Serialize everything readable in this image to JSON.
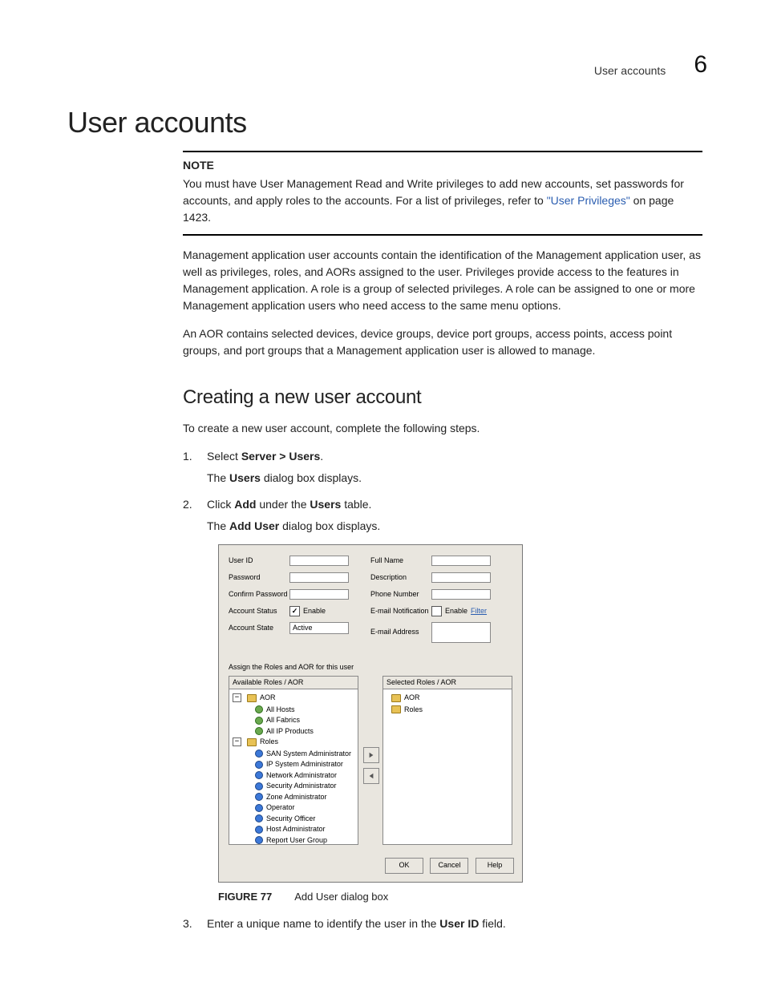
{
  "header": {
    "section": "User accounts",
    "chapter_num": "6"
  },
  "title": "User accounts",
  "note": {
    "label": "NOTE",
    "text_a": "You must have User Management Read and Write privileges to add new accounts, set passwords for accounts, and apply roles to the accounts. For a list of privileges, refer to ",
    "link": "\"User Privileges\"",
    "text_b": " on page 1423."
  },
  "para1": "Management application user accounts contain the identification of the Management application user, as well as privileges, roles, and AORs assigned to the user. Privileges provide access to the features in Management application. A role is a group of selected privileges. A role can be assigned to one or more Management application users who need access to the same menu options.",
  "para2": "An AOR contains selected devices, device groups, device port groups, access points, access point groups, and port groups that a Management application user is allowed to manage.",
  "subheading": "Creating a new user account",
  "intro": "To create a new user account, complete the following steps.",
  "steps": {
    "s1": {
      "pre": "Select ",
      "bold": "Server > Users",
      "post": ".",
      "after_pre": "The ",
      "after_bold": "Users",
      "after_post": " dialog box displays."
    },
    "s2": {
      "pre": "Click ",
      "b1": "Add",
      "mid": " under the ",
      "b2": "Users",
      "post": " table.",
      "after_pre": "The ",
      "after_bold": "Add User",
      "after_post": " dialog box displays."
    },
    "s3": {
      "pre": "Enter a unique name to identify the user in the ",
      "bold": "User ID",
      "post": " field."
    }
  },
  "dialog": {
    "left_labels": {
      "user_id": "User ID",
      "password": "Password",
      "confirm": "Confirm Password",
      "acct_status": "Account Status",
      "acct_state": "Account State"
    },
    "right_labels": {
      "full_name": "Full Name",
      "desc": "Description",
      "phone": "Phone Number",
      "email_notif": "E-mail Notification",
      "email_addr": "E-mail Address"
    },
    "enable": "Enable",
    "state_value": "Active",
    "filter": "Filter",
    "assign": "Assign the Roles and AOR for this user",
    "avail_hdr": "Available Roles / AOR",
    "sel_hdr": "Selected Roles / AOR",
    "aor_root": "AOR",
    "aor_items": [
      "All Hosts",
      "All Fabrics",
      "All IP Products"
    ],
    "roles_root": "Roles",
    "role_items": [
      "SAN System Administrator",
      "IP System Administrator",
      "Network Administrator",
      "Security Administrator",
      "Zone Administrator",
      "Operator",
      "Security Officer",
      "Host Administrator",
      "Report User Group"
    ],
    "sel_aor": "AOR",
    "sel_roles": "Roles",
    "buttons": {
      "ok": "OK",
      "cancel": "Cancel",
      "help": "Help"
    }
  },
  "figure": {
    "label": "FIGURE 77",
    "caption": "Add User dialog box"
  }
}
